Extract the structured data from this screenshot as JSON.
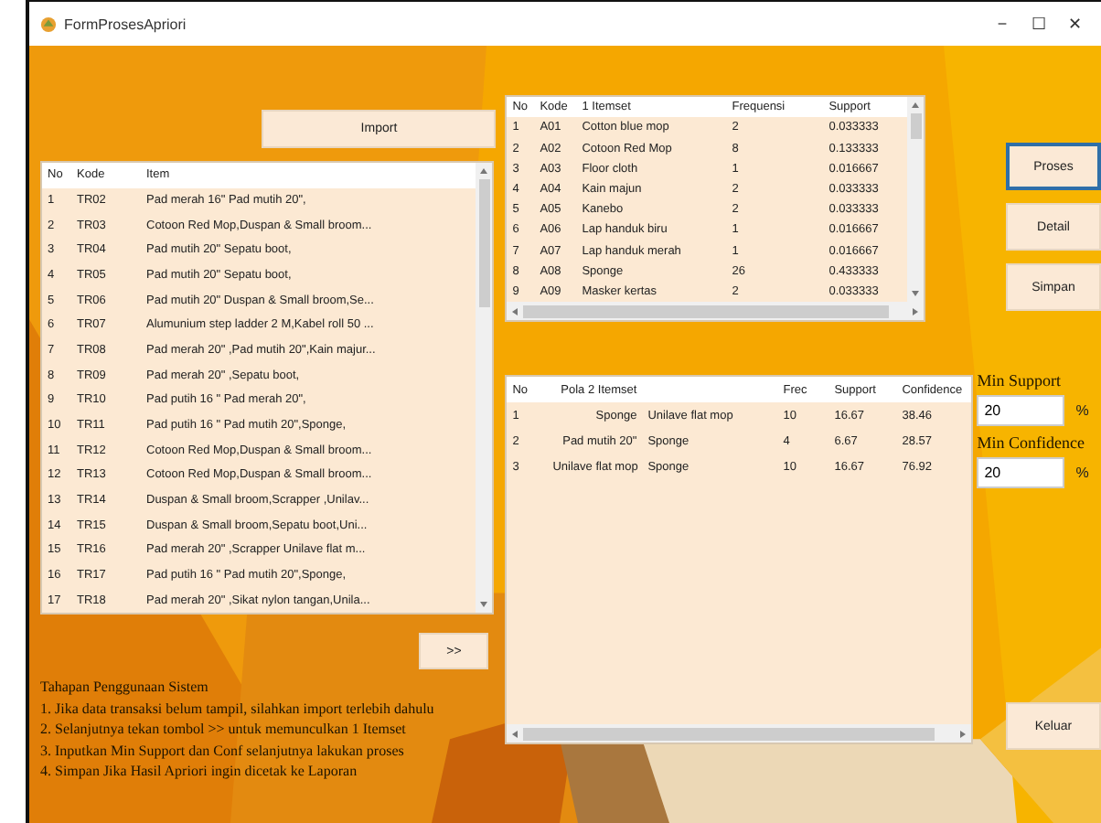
{
  "window": {
    "title": "FormProsesApriori",
    "controls": [
      "−",
      "☐",
      "✕"
    ]
  },
  "import_button": {
    "label": "Import"
  },
  "transactions": {
    "columns": [
      "No",
      "Kode",
      "Item"
    ],
    "rows": [
      [
        "1",
        "TR02",
        "Pad merah 16\" Pad mutih 20\","
      ],
      [
        "2",
        "TR03",
        "Cotoon Red Mop,Duspan & Small broom..."
      ],
      [
        "3",
        "TR04",
        "Pad mutih 20\" Sepatu boot,"
      ],
      [
        "4",
        "TR05",
        "Pad mutih 20\" Sepatu boot,"
      ],
      [
        "5",
        "TR06",
        "Pad mutih 20\" Duspan & Small broom,Se..."
      ],
      [
        "6",
        "TR07",
        "Alumunium step ladder 2 M,Kabel roll 50 ..."
      ],
      [
        "7",
        "TR08",
        "Pad merah 20\" ,Pad mutih 20\",Kain majur..."
      ],
      [
        "8",
        "TR09",
        "Pad merah 20\" ,Sepatu boot,"
      ],
      [
        "9",
        "TR10",
        "Pad putih 16 \" Pad merah 20\","
      ],
      [
        "10",
        "TR11",
        "Pad putih 16 \" Pad mutih 20\",Sponge,"
      ],
      [
        "11",
        "TR12",
        "Cotoon Red Mop,Duspan & Small broom..."
      ],
      [
        "12",
        "TR13",
        "Cotoon Red Mop,Duspan & Small broom..."
      ],
      [
        "13",
        "TR14",
        "Duspan & Small broom,Scrapper ,Unilav..."
      ],
      [
        "14",
        "TR15",
        "Duspan & Small broom,Sepatu boot,Uni..."
      ],
      [
        "15",
        "TR16",
        "Pad merah 20\" ,Scrapper Unilave flat m..."
      ],
      [
        "16",
        "TR17",
        "Pad putih 16 \" Pad mutih 20\",Sponge,"
      ],
      [
        "17",
        "TR18",
        "Pad merah 20\" ,Sikat nylon tangan,Unila..."
      ]
    ]
  },
  "next_button": {
    "label": ">>"
  },
  "instructions": {
    "title": "Tahapan Penggunaan Sistem",
    "steps": [
      "1. Jika data transaksi belum tampil, silahkan import terlebih dahulu",
      "2. Selanjutnya tekan tombol >> untuk memunculkan 1 Itemset",
      "3. Inputkan Min Support dan Conf selanjutnya lakukan proses",
      "4. Simpan Jika Hasil Apriori ingin dicetak ke Laporan"
    ]
  },
  "itemset_table": {
    "columns": [
      "No",
      "Kode",
      "1 Itemset",
      "Frequensi",
      "Support"
    ],
    "rows": [
      [
        "1",
        "A01",
        "Cotton blue mop",
        "2",
        "0.033333"
      ],
      [
        "2",
        "A02",
        "Cotoon Red Mop",
        "8",
        "0.133333"
      ],
      [
        "3",
        "A03",
        "Floor cloth",
        "1",
        "0.016667"
      ],
      [
        "4",
        "A04",
        "Kain majun",
        "2",
        "0.033333"
      ],
      [
        "5",
        "A05",
        "Kanebo",
        "2",
        "0.033333"
      ],
      [
        "6",
        "A06",
        "Lap handuk biru",
        "1",
        "0.016667"
      ],
      [
        "7",
        "A07",
        "Lap handuk merah",
        "1",
        "0.016667"
      ],
      [
        "8",
        "A08",
        "Sponge",
        "26",
        "0.433333"
      ],
      [
        "9",
        "A09",
        "Masker kertas",
        "2",
        "0.033333"
      ]
    ]
  },
  "pattern_table": {
    "columns": [
      "No",
      "Pola 2 Itemset",
      "",
      "Frec",
      "Support",
      "Confidence"
    ],
    "rows": [
      [
        "1",
        "Sponge",
        "Unilave flat mop",
        "10",
        "16.67",
        "38.46"
      ],
      [
        "2",
        "Pad mutih 20\"",
        "Sponge",
        "4",
        "6.67",
        "28.57"
      ],
      [
        "3",
        "Unilave flat mop",
        "Sponge",
        "10",
        "16.67",
        "76.92"
      ]
    ]
  },
  "action_buttons": [
    {
      "label": "Proses",
      "focused": true
    },
    {
      "label": "Detail",
      "focused": false
    },
    {
      "label": "Simpan",
      "focused": false
    }
  ],
  "min_support": {
    "label": "Min Support",
    "value": "20",
    "unit": "%"
  },
  "min_confidence": {
    "label": "Min Confidence",
    "value": "20",
    "unit": "%"
  },
  "exit_button": {
    "label": "Keluar"
  }
}
